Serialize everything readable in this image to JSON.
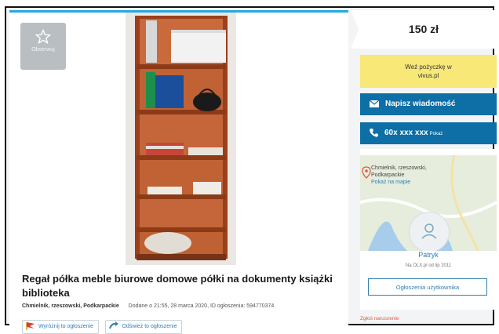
{
  "listing": {
    "observe_label": "Obserwuj",
    "title": "Regał półka meble biurowe domowe półki na dokumenty książki biblioteka",
    "location": "Chmielnik, rzeszowski, Podkarpackie",
    "added_info": "Dodane o 21:55, 28 marca 2020, ID ogłoszenia: 594770374",
    "promote_label": "Wyróżnij to ogłoszenie",
    "refresh_label": "Odśwież to ogłoszenie"
  },
  "sidebar": {
    "price": "150 zł",
    "loan_line1": "Weź pożyczkę w",
    "loan_line2": "vivus.pl",
    "message_label": "Napisz wiadomość",
    "phone_label": "60x xxx xxx",
    "phone_show": "Pokaż",
    "map_location_line1": "Chmielnik, rzeszowski,",
    "map_location_line2": "Podkarpackie",
    "map_link": "Pokaż na mapie",
    "user_name": "Patryk",
    "user_since": "Na OLX.pl od lip 2011",
    "user_ads_label": "Ogłoszenia użytkownika",
    "report_label": "Zgłoś naruszenie"
  },
  "colors": {
    "accent": "#0e6ea6",
    "top_bar": "#23a9e0",
    "loan_bg": "#f8e878",
    "report": "#e05a44"
  },
  "icons": {
    "observe": "star-icon",
    "message": "envelope-icon",
    "phone": "phone-icon",
    "map_pin": "pin-icon",
    "avatar": "user-icon",
    "promote": "flag-icon",
    "refresh": "refresh-icon"
  }
}
